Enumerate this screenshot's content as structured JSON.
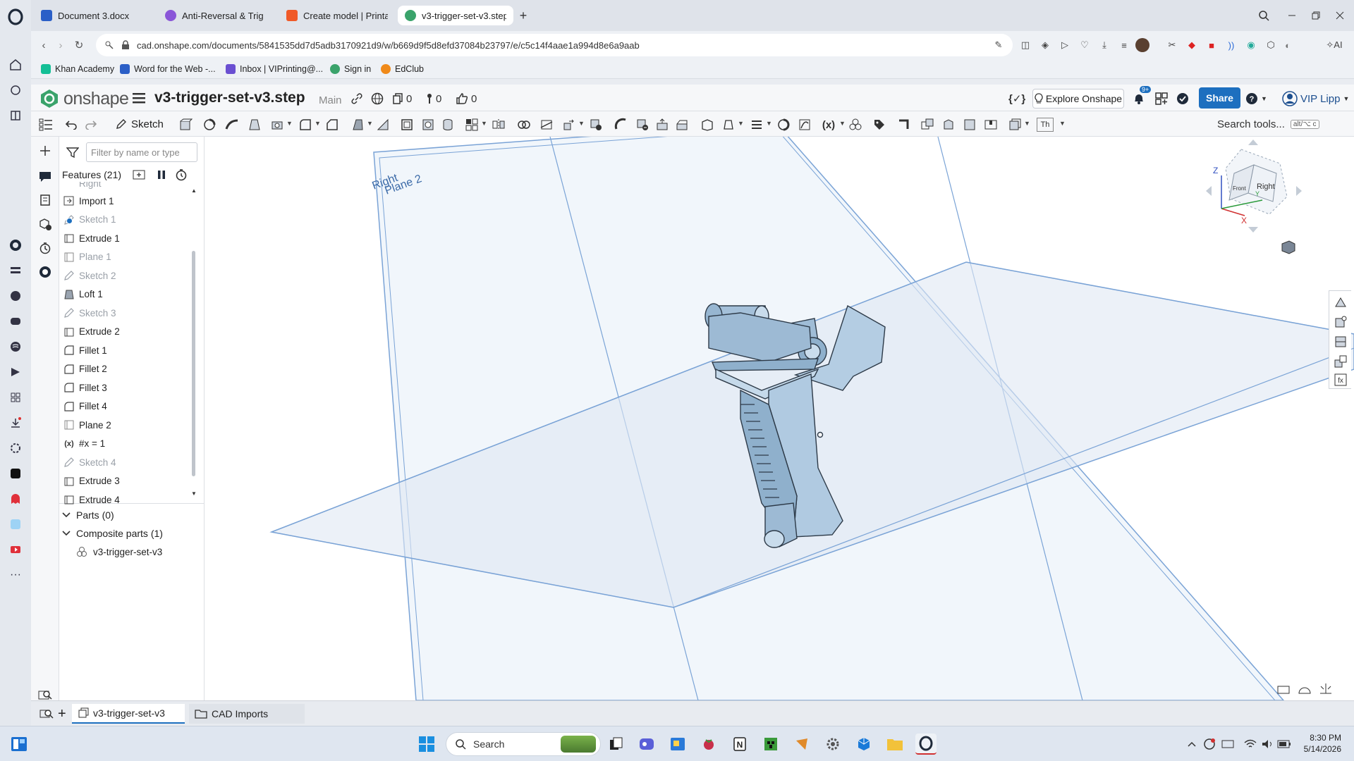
{
  "browser": {
    "tabs": [
      {
        "label": "Document 3.docx",
        "color": "#2b5fc7"
      },
      {
        "label": "Anti-Reversal & Trig",
        "color": "#8a56d8"
      },
      {
        "label": "Create model | Printable",
        "color": "#f05a28"
      },
      {
        "label": "v3-trigger-set-v3.step |",
        "color": "#3aa36b"
      }
    ],
    "new_tab": "+",
    "url": "cad.onshape.com/documents/5841535dd7d5adb3170921d9/w/b669d9f5d8efd37084b23797/e/c5c14f4aae1a994d8e6a9aab",
    "bookmarks": [
      {
        "label": "Khan Academy",
        "color": "#14bf96"
      },
      {
        "label": "Word for the Web -...",
        "color": "#2b5fc7"
      },
      {
        "label": "Inbox | VIPrinting@...",
        "color": "#6a4fd1"
      },
      {
        "label": "Sign in",
        "color": "#3aa36b"
      },
      {
        "label": "EdClub",
        "color": "#f08a1a"
      }
    ]
  },
  "onshape": {
    "logo_text": "onshape",
    "doc_title": "v3-trigger-set-v3.step",
    "branch": "Main",
    "versions_count": "0",
    "tasks_count": "0",
    "likes_count": "0",
    "explore_label": "Explore Onshape",
    "notif_badge": "9+",
    "share_label": "Share",
    "user_name": "VIP Lipp",
    "accent": "#1d6fbf",
    "toolbar": {
      "sketch_label": "Sketch",
      "search_label": "Search tools...",
      "search_shortcut": "alt/⌥ c",
      "th_label": "Th"
    }
  },
  "feature_panel": {
    "filter_placeholder": "Filter by name or type",
    "features_header": "Features (21)",
    "partial_top": "Right",
    "features": [
      {
        "label": "Import 1",
        "suppressed": false,
        "icon": "import-icon"
      },
      {
        "label": "Sketch 1",
        "suppressed": true,
        "icon": "sketch-icon"
      },
      {
        "label": "Extrude 1",
        "suppressed": false,
        "icon": "extrude-icon"
      },
      {
        "label": "Plane 1",
        "suppressed": true,
        "icon": "plane-icon"
      },
      {
        "label": "Sketch 2",
        "suppressed": true,
        "icon": "sketch-icon"
      },
      {
        "label": "Loft 1",
        "suppressed": false,
        "icon": "loft-icon"
      },
      {
        "label": "Sketch 3",
        "suppressed": true,
        "icon": "sketch-icon"
      },
      {
        "label": "Extrude 2",
        "suppressed": false,
        "icon": "extrude-icon"
      },
      {
        "label": "Fillet 1",
        "suppressed": false,
        "icon": "fillet-icon"
      },
      {
        "label": "Fillet 2",
        "suppressed": false,
        "icon": "fillet-icon"
      },
      {
        "label": "Fillet 3",
        "suppressed": false,
        "icon": "fillet-icon"
      },
      {
        "label": "Fillet 4",
        "suppressed": false,
        "icon": "fillet-icon"
      },
      {
        "label": "Plane 2",
        "suppressed": false,
        "icon": "plane-icon"
      },
      {
        "label": "#x = 1",
        "suppressed": false,
        "icon": "variable-icon"
      },
      {
        "label": "Sketch 4",
        "suppressed": true,
        "icon": "sketch-icon"
      },
      {
        "label": "Extrude 3",
        "suppressed": false,
        "icon": "extrude-icon"
      },
      {
        "label": "Extrude 4",
        "suppressed": false,
        "icon": "extrude-icon"
      }
    ],
    "parts_label": "Parts (0)",
    "composite_label": "Composite parts (1)",
    "composite_item": "v3-trigger-set-v3"
  },
  "viewport": {
    "plane_label_right": "Right",
    "plane_label_2": "Plane 2",
    "cube_front": "Front",
    "cube_right": "Right",
    "axis_z": "Z",
    "axis_x": "X",
    "axis_y": "Y",
    "plane_color": "#7aa3d6",
    "part_color": "#a9c4dd"
  },
  "doc_tabs": {
    "part_studio": "v3-trigger-set-v3",
    "cad_imports": "CAD Imports",
    "add": "+"
  },
  "taskbar": {
    "search_label": "Search",
    "time": "8:30 PM",
    "date": "5/14/2026"
  }
}
